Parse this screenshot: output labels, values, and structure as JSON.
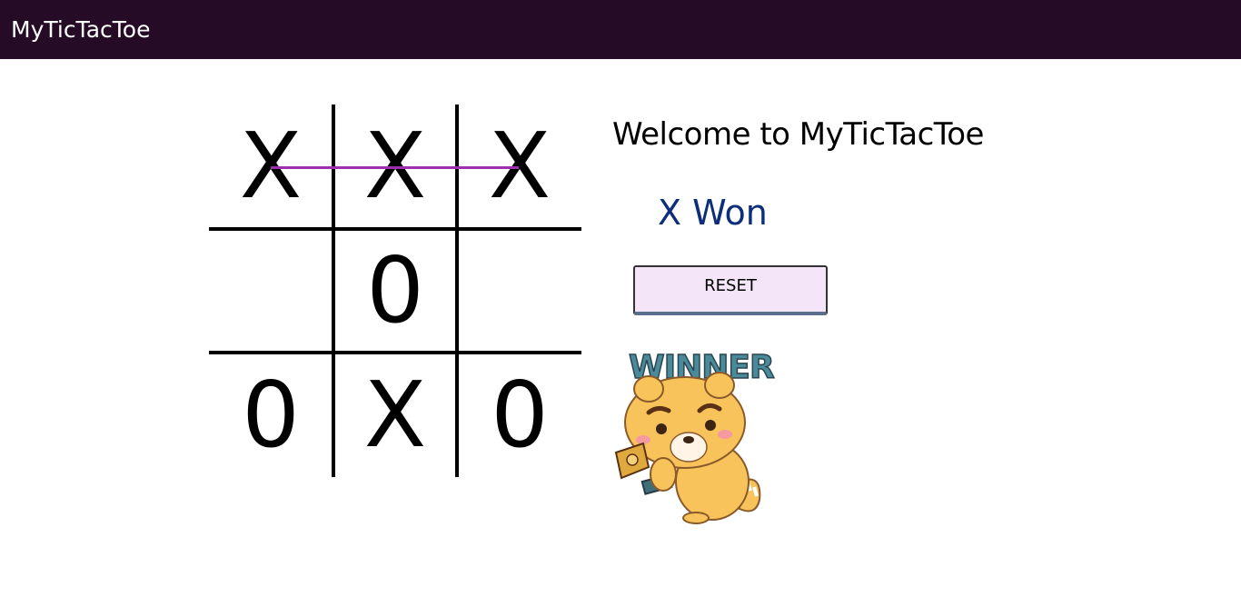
{
  "app": {
    "title": "MyTicTacToe"
  },
  "board": {
    "cells": [
      "X",
      "X",
      "X",
      "",
      "0",
      "",
      "0",
      "X",
      "0"
    ],
    "winning_line": "top-row"
  },
  "panel": {
    "welcome": "Welcome to MyTicTacToe",
    "status": "X Won",
    "reset_label": "RESET",
    "winner_image_text": "WINNER"
  },
  "colors": {
    "appbar": "#260b26",
    "status": "#0d2f79",
    "win_line": "#9b2fae",
    "reset_bg": "#f4e6f8"
  }
}
